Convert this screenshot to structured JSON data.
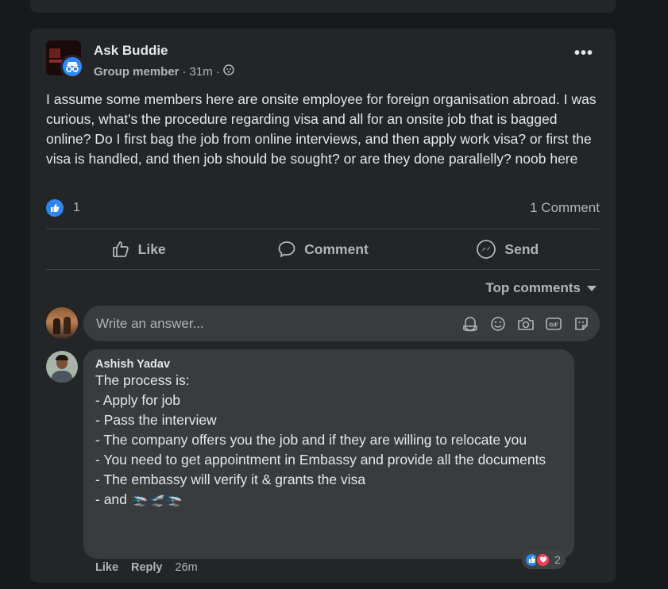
{
  "post": {
    "author": "Ask Buddie",
    "role": "Group member",
    "time": "31m",
    "body": "I assume some members here are onsite employee for foreign organisation abroad. I was curious, what's the procedure regarding visa and all for an onsite job that is bagged online? Do I first bag the job from online interviews, and then apply work visa? or first the visa is handled, and then job should be sought? or are they done parallelly? noob here",
    "reaction_count": "1",
    "comment_count": "1 Comment"
  },
  "actions": {
    "like": "Like",
    "comment": "Comment",
    "send": "Send"
  },
  "comments_sort": "Top comments",
  "composer": {
    "placeholder": "Write an answer..."
  },
  "comment": {
    "author": "Ashish Yadav",
    "lines": [
      "The process is:",
      "- Apply for job",
      "- Pass the interview",
      "- The company offers you the job and if they are willing to relocate you",
      "- You need to get appointment in Embassy and provide all the documents",
      "- The embassy will verify it & grants the visa",
      "- and 🛬🛫🛬"
    ],
    "reaction_count": "2",
    "like_label": "Like",
    "reply_label": "Reply",
    "time": "26m"
  },
  "colors": {
    "background": "#18191a",
    "card": "#242526",
    "bubble": "#3a3b3c",
    "accent": "#2d88ff",
    "love": "#f33e58"
  },
  "icons": [
    "more-options-icon",
    "anonymous-icon",
    "globe-icon",
    "like-icon",
    "comment-icon",
    "messenger-icon",
    "avatar-frame-icon",
    "emoji-icon",
    "camera-icon",
    "gif-icon",
    "sticker-icon",
    "love-icon"
  ]
}
